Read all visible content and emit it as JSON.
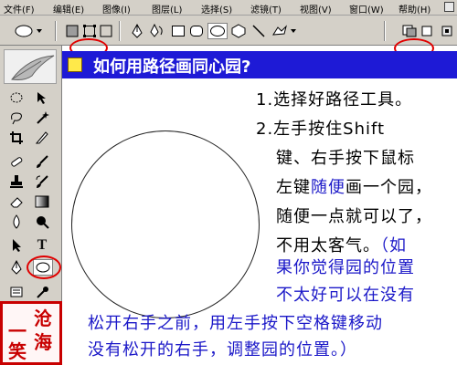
{
  "menubar": {
    "items": [
      "文件(F)",
      "编辑(E)",
      "图像(I)",
      "图层(L)",
      "选择(S)",
      "滤镜(T)",
      "视图(V)",
      "窗口(W)",
      "帮助(H)"
    ]
  },
  "options_bar": {
    "icons": [
      "ellipse-tool-preset-icon",
      "shape-layers-icon",
      "paths-icon",
      "fill-pixels-icon",
      "pen-icon",
      "freeform-pen-icon",
      "rectangle-icon",
      "rounded-rectangle-icon",
      "ellipse-icon",
      "polygon-icon",
      "line-icon",
      "custom-shape-icon",
      "path-area-option-icon",
      "palette-well-icon"
    ]
  },
  "toolbox": {
    "tools": [
      "marquee",
      "move",
      "lasso",
      "magic-wand",
      "crop",
      "slice",
      "healing-brush",
      "brush",
      "clone-stamp",
      "history-brush",
      "eraser",
      "gradient",
      "blur",
      "dodge",
      "path-selection",
      "type",
      "pen",
      "ellipse",
      "notes",
      "eyedropper"
    ],
    "type_tool_label": "T"
  },
  "stamp": {
    "chars": [
      "一",
      "沧",
      "笑",
      "海"
    ]
  },
  "document": {
    "title": "如何用路径画同心园?",
    "lines": [
      "1.选择好路径工具。",
      "2.左手按住Shift",
      "键、右手按下鼠标",
      "左键",
      "随便",
      "画一个园，",
      "随便一点就可以了，",
      "不用太客气。",
      "（如",
      "果你觉得园的位置",
      "不太好可以在没有",
      "松开右手之前，用左手按下空格键移动",
      "没有松开的右手，调整园的位置。）"
    ]
  },
  "colors": {
    "chrome": "#d4d0c8",
    "title_bar": "#1e1ad6",
    "highlight_ring": "#e00000",
    "note_text": "#1b18c8"
  }
}
